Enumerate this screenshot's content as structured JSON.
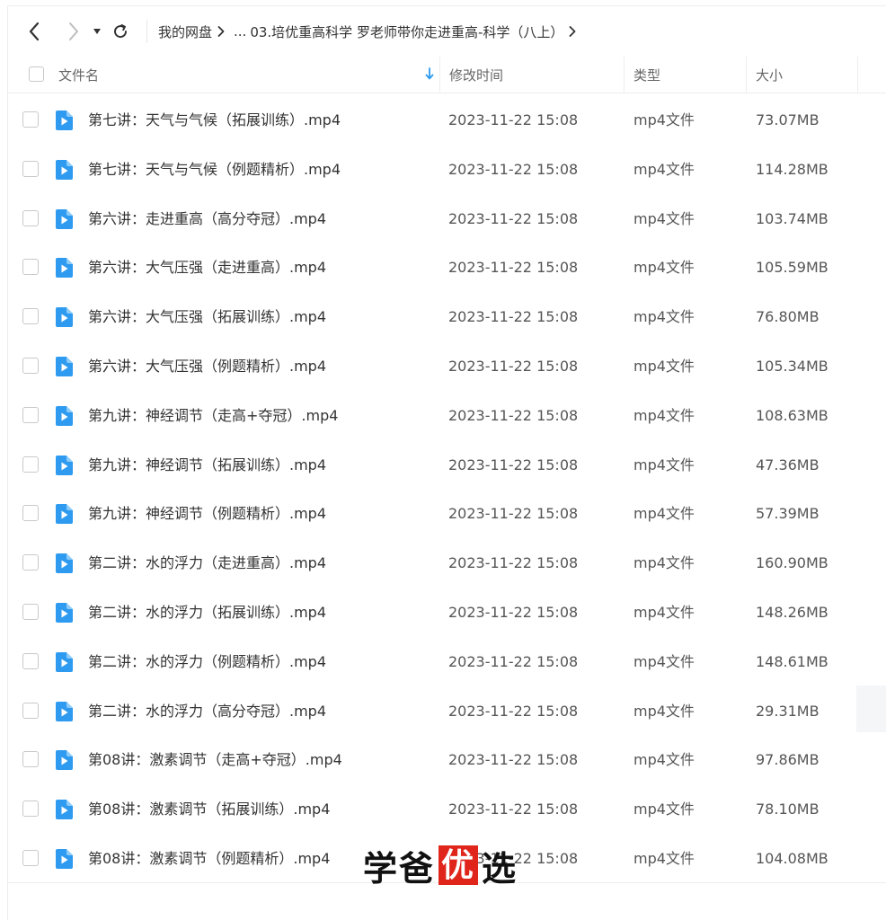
{
  "toolbar": {
    "breadcrumb": {
      "root": "我的网盘",
      "ellipsis": "...",
      "current": "03.培优重高科学 罗老师带你走进重高-科学（八上）"
    }
  },
  "columns": {
    "name": "文件名",
    "modified": "修改时间",
    "type": "类型",
    "size": "大小"
  },
  "files": [
    {
      "name": "第七讲：天气与气候（拓展训练）.mp4",
      "modified": "2023-11-22 15:08",
      "type": "mp4文件",
      "size": "73.07MB"
    },
    {
      "name": "第七讲：天气与气候（例题精析）.mp4",
      "modified": "2023-11-22 15:08",
      "type": "mp4文件",
      "size": "114.28MB"
    },
    {
      "name": "第六讲：走进重高（高分夺冠）.mp4",
      "modified": "2023-11-22 15:08",
      "type": "mp4文件",
      "size": "103.74MB"
    },
    {
      "name": "第六讲：大气压强（走进重高）.mp4",
      "modified": "2023-11-22 15:08",
      "type": "mp4文件",
      "size": "105.59MB"
    },
    {
      "name": "第六讲：大气压强（拓展训练）.mp4",
      "modified": "2023-11-22 15:08",
      "type": "mp4文件",
      "size": "76.80MB"
    },
    {
      "name": "第六讲：大气压强（例题精析）.mp4",
      "modified": "2023-11-22 15:08",
      "type": "mp4文件",
      "size": "105.34MB"
    },
    {
      "name": "第九讲：神经调节（走高+夺冠）.mp4",
      "modified": "2023-11-22 15:08",
      "type": "mp4文件",
      "size": "108.63MB"
    },
    {
      "name": "第九讲：神经调节（拓展训练）.mp4",
      "modified": "2023-11-22 15:08",
      "type": "mp4文件",
      "size": "47.36MB"
    },
    {
      "name": "第九讲：神经调节（例题精析）.mp4",
      "modified": "2023-11-22 15:08",
      "type": "mp4文件",
      "size": "57.39MB"
    },
    {
      "name": "第二讲：水的浮力（走进重高）.mp4",
      "modified": "2023-11-22 15:08",
      "type": "mp4文件",
      "size": "160.90MB"
    },
    {
      "name": "第二讲：水的浮力（拓展训练）.mp4",
      "modified": "2023-11-22 15:08",
      "type": "mp4文件",
      "size": "148.26MB"
    },
    {
      "name": "第二讲：水的浮力（例题精析）.mp4",
      "modified": "2023-11-22 15:08",
      "type": "mp4文件",
      "size": "148.61MB"
    },
    {
      "name": "第二讲：水的浮力（高分夺冠）.mp4",
      "modified": "2023-11-22 15:08",
      "type": "mp4文件",
      "size": "29.31MB"
    },
    {
      "name": "第08讲：激素调节（走高+夺冠）.mp4",
      "modified": "2023-11-22 15:08",
      "type": "mp4文件",
      "size": "97.86MB"
    },
    {
      "name": "第08讲：激素调节（拓展训练）.mp4",
      "modified": "2023-11-22 15:08",
      "type": "mp4文件",
      "size": "78.10MB"
    },
    {
      "name": "第08讲：激素调节（例题精析）.mp4",
      "modified": "2023-11-22 15:08",
      "type": "mp4文件",
      "size": "104.08MB"
    }
  ],
  "watermark": {
    "part1": "学爸",
    "part2": "优",
    "part3": "选"
  },
  "colors": {
    "video_icon": "#2e9bf0",
    "sort_arrow": "#2e9bf0",
    "watermark_box": "#e0251b"
  },
  "icons": {
    "back": "chevron-left-icon",
    "forward": "chevron-right-icon",
    "dropdown": "caret-down-icon",
    "refresh": "refresh-icon",
    "sort": "sort-arrow-down-icon",
    "file": "video-file-icon"
  }
}
